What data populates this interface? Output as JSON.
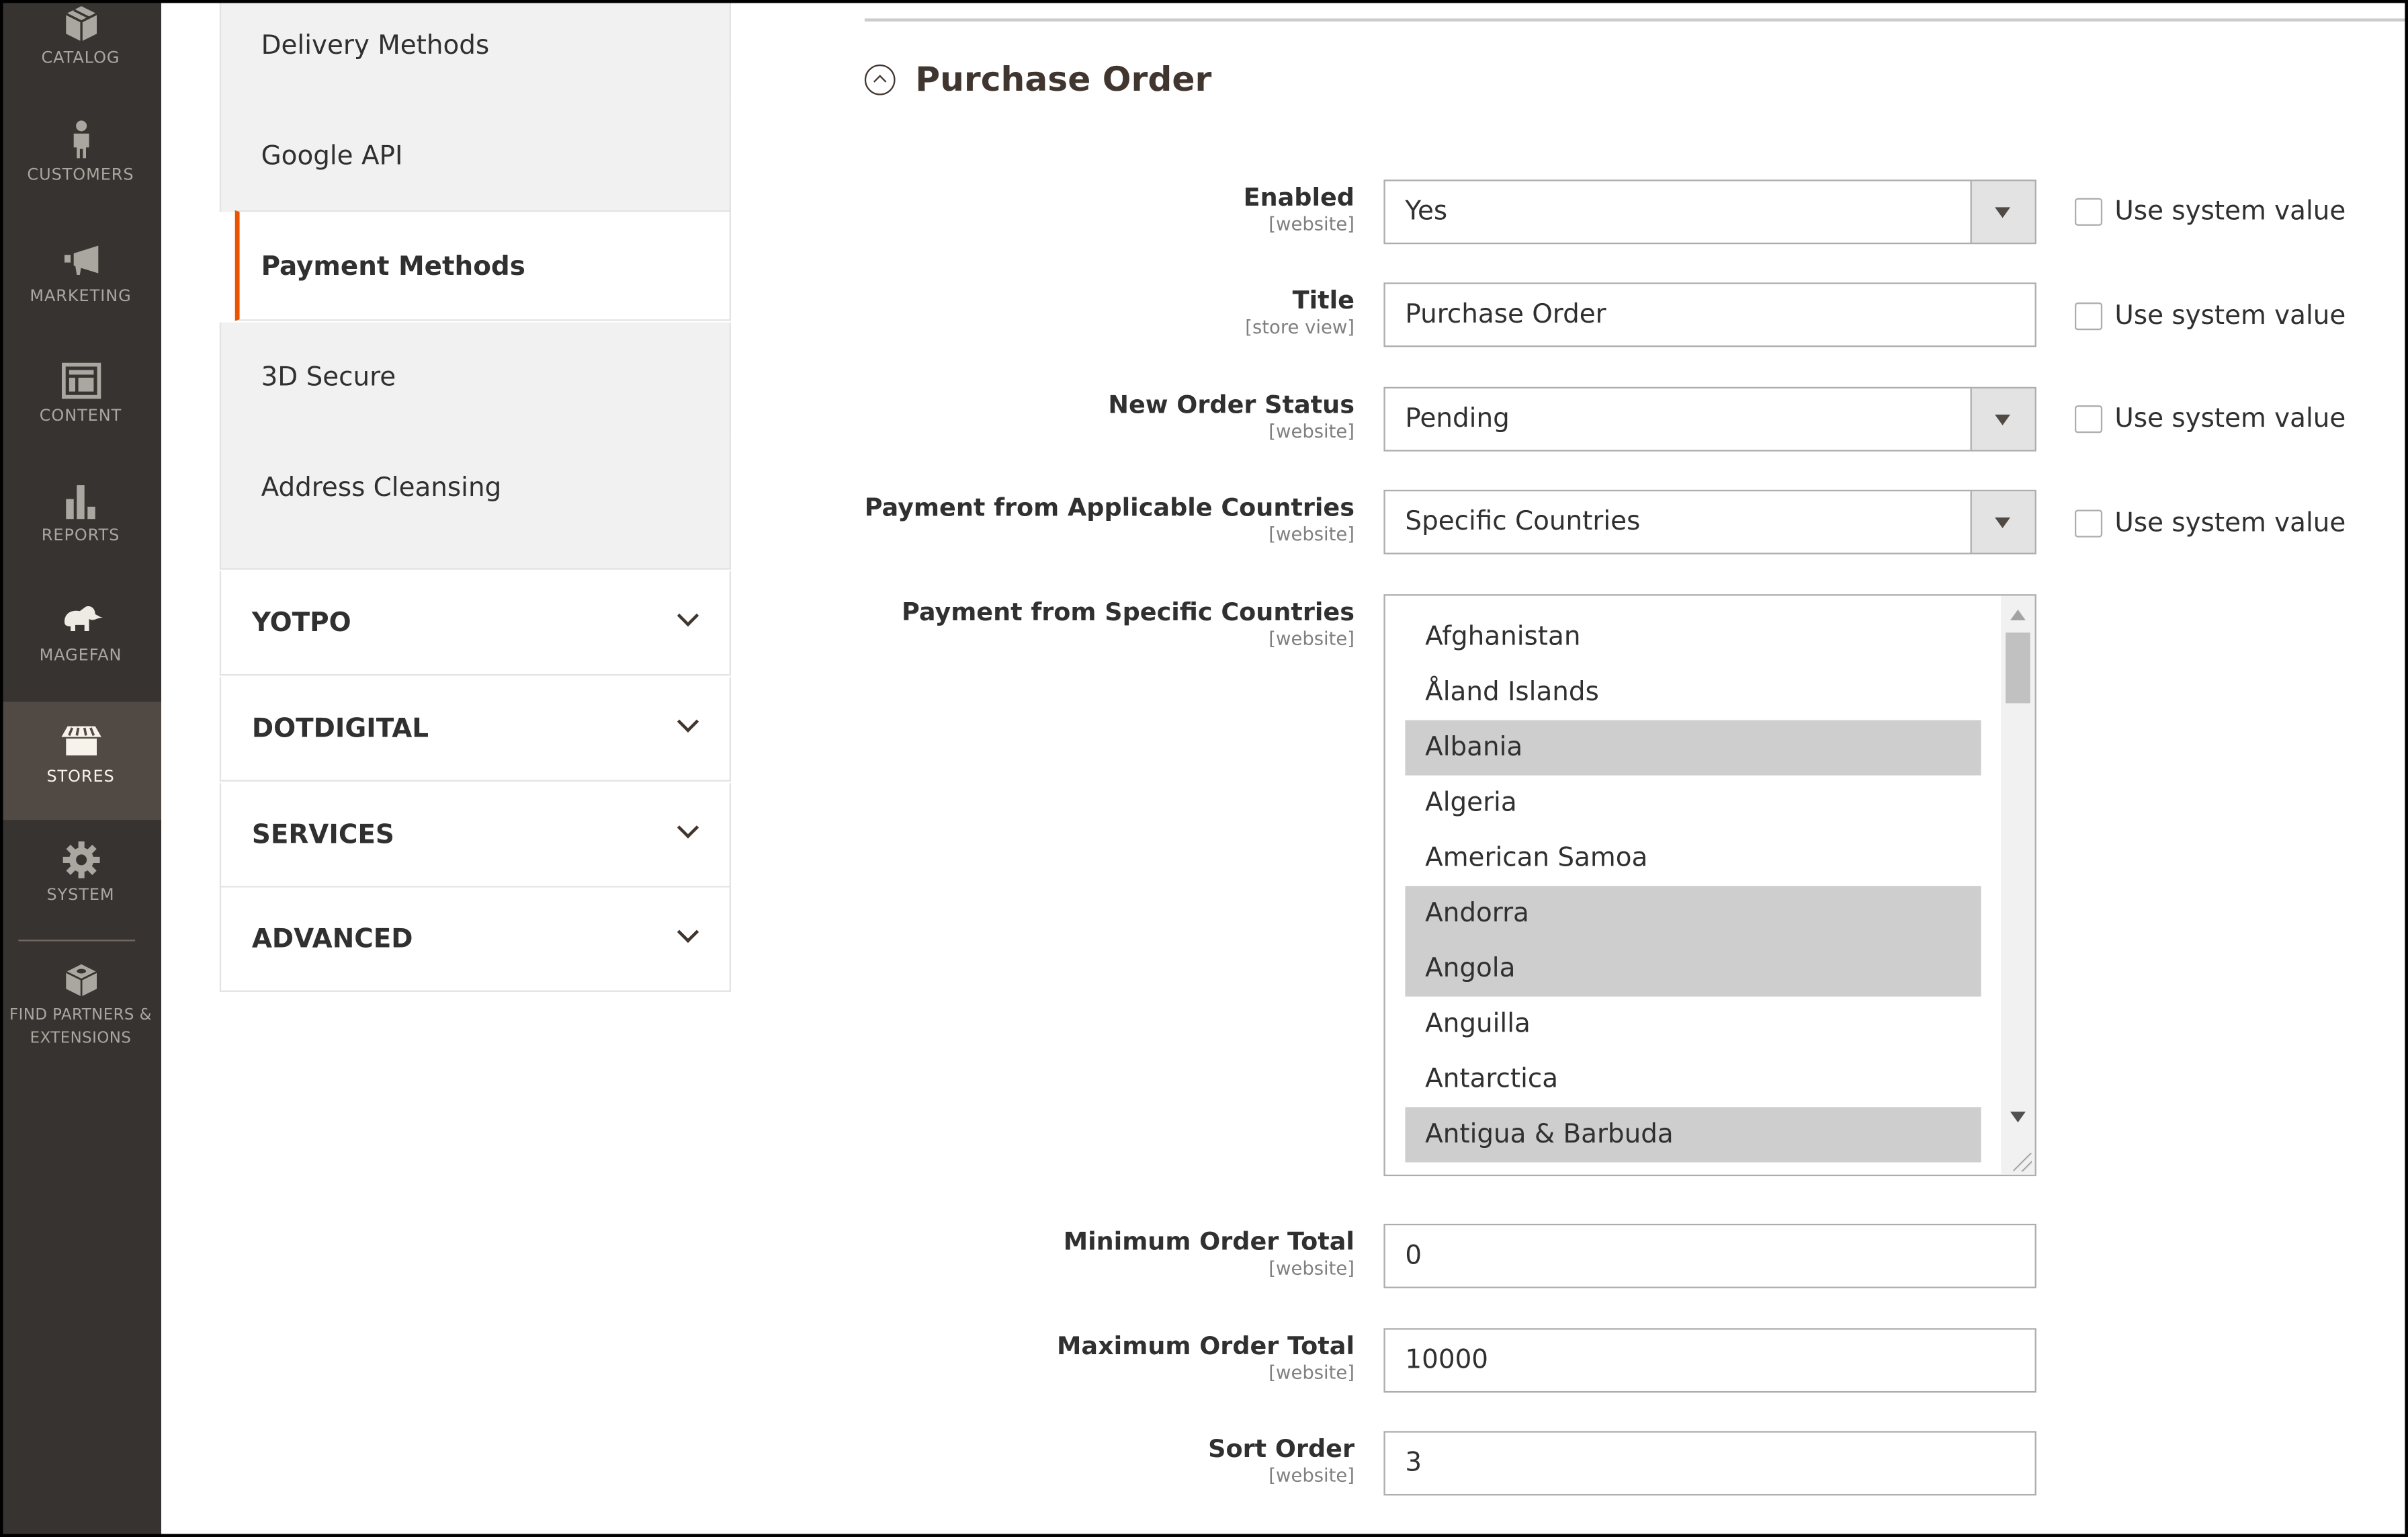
{
  "admin_nav": {
    "items": [
      {
        "icon": "box-icon",
        "label": "Catalog"
      },
      {
        "icon": "person-icon",
        "label": "Customers"
      },
      {
        "icon": "megaphone-icon",
        "label": "Marketing"
      },
      {
        "icon": "layout-icon",
        "label": "Content"
      },
      {
        "icon": "bar-chart-icon",
        "label": "Reports"
      },
      {
        "icon": "elephant-icon",
        "label": "Magefan"
      },
      {
        "icon": "store-icon",
        "label": "Stores",
        "active": true
      },
      {
        "icon": "gear-icon",
        "label": "System"
      },
      {
        "icon": "cube-icon",
        "label": "Find Partners & Extensions"
      }
    ]
  },
  "config_nav": {
    "sub_items": [
      {
        "label": "Delivery Methods"
      },
      {
        "label": "Google API"
      },
      {
        "label": "Payment Methods",
        "active": true
      },
      {
        "label": "3D Secure"
      },
      {
        "label": "Address Cleansing"
      }
    ],
    "sections": [
      {
        "label": "YOTPO"
      },
      {
        "label": "DOTDIGITAL"
      },
      {
        "label": "SERVICES"
      },
      {
        "label": "ADVANCED"
      }
    ]
  },
  "section": {
    "title": "Purchase Order",
    "use_system_value_label": "Use system value",
    "fields": {
      "enabled": {
        "label": "Enabled",
        "scope": "[website]",
        "value": "Yes",
        "use_system_value": false
      },
      "title": {
        "label": "Title",
        "scope": "[store view]",
        "value": "Purchase Order",
        "use_system_value": false
      },
      "new_order_status": {
        "label": "New Order Status",
        "scope": "[website]",
        "value": "Pending",
        "use_system_value": false
      },
      "applicable_countries": {
        "label": "Payment from Applicable Countries",
        "scope": "[website]",
        "value": "Specific Countries",
        "use_system_value": false
      },
      "specific_countries": {
        "label": "Payment from Specific Countries",
        "scope": "[website]",
        "options": [
          {
            "label": "Afghanistan",
            "selected": false
          },
          {
            "label": "Åland Islands",
            "selected": false
          },
          {
            "label": "Albania",
            "selected": true
          },
          {
            "label": "Algeria",
            "selected": false
          },
          {
            "label": "American Samoa",
            "selected": false
          },
          {
            "label": "Andorra",
            "selected": true
          },
          {
            "label": "Angola",
            "selected": true
          },
          {
            "label": "Anguilla",
            "selected": false
          },
          {
            "label": "Antarctica",
            "selected": false
          },
          {
            "label": "Antigua & Barbuda",
            "selected": true
          }
        ]
      },
      "min_order_total": {
        "label": "Minimum Order Total",
        "scope": "[website]",
        "value": "0"
      },
      "max_order_total": {
        "label": "Maximum Order Total",
        "scope": "[website]",
        "value": "10000"
      },
      "sort_order": {
        "label": "Sort Order",
        "scope": "[website]",
        "value": "3"
      }
    }
  },
  "colors": {
    "accent": "#eb5202",
    "nav_bg": "#373330",
    "nav_active": "#514943",
    "selected_option": "#cecece"
  }
}
